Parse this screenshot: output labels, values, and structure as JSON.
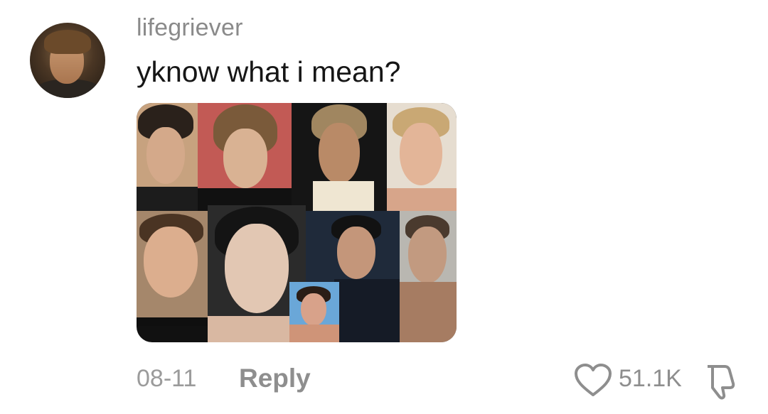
{
  "comment": {
    "username": "lifegriever",
    "text": "yknow what i mean?",
    "date": "08-11",
    "reply_label": "Reply",
    "like_count": "51.1K"
  },
  "icons": {
    "like": "heart-outline-icon",
    "dislike": "thumbs-down-outline-icon"
  },
  "colors": {
    "username": "#8a8a8a",
    "text": "#161616",
    "meta": "#8e8e8e"
  }
}
